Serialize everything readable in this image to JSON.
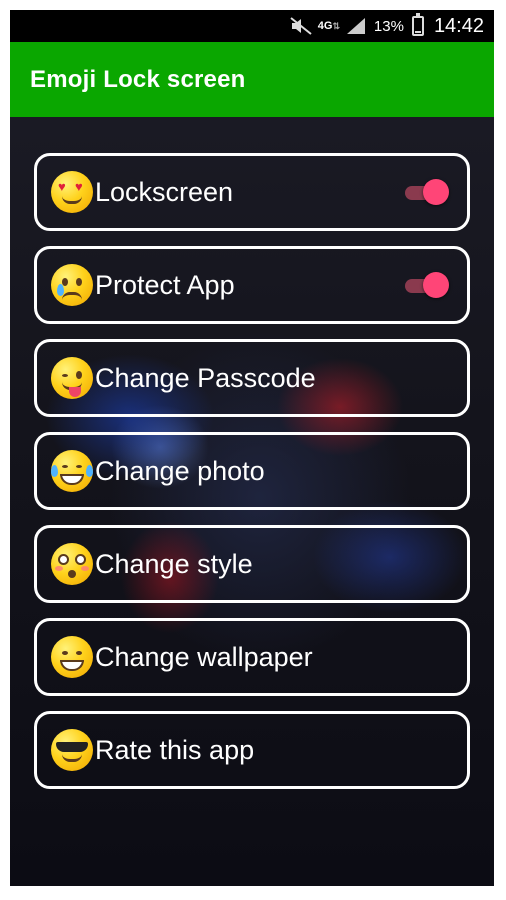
{
  "status_bar": {
    "network": "4G",
    "battery_percent": "13%",
    "time": "14:42",
    "icons": [
      "mute-icon",
      "signal-icon",
      "battery-icon"
    ]
  },
  "app_bar": {
    "title": "Emoji Lock screen"
  },
  "menu": {
    "items": [
      {
        "label": "Lockscreen",
        "emoji": "heart-eyes-emoji-icon",
        "toggle": true,
        "toggle_on": true
      },
      {
        "label": "Protect App",
        "emoji": "crying-emoji-icon",
        "toggle": true,
        "toggle_on": true
      },
      {
        "label": "Change Passcode",
        "emoji": "tongue-wink-emoji-icon"
      },
      {
        "label": "Change photo",
        "emoji": "tears-of-joy-emoji-icon"
      },
      {
        "label": "Change style",
        "emoji": "flushed-emoji-icon"
      },
      {
        "label": "Change wallpaper",
        "emoji": "grinning-emoji-icon"
      },
      {
        "label": "Rate this app",
        "emoji": "sunglasses-emoji-icon"
      }
    ]
  },
  "colors": {
    "app_bar": "#0aa700",
    "toggle_thumb": "#ff4577",
    "toggle_track": "#8a3a4e",
    "item_border": "#ffffff"
  }
}
